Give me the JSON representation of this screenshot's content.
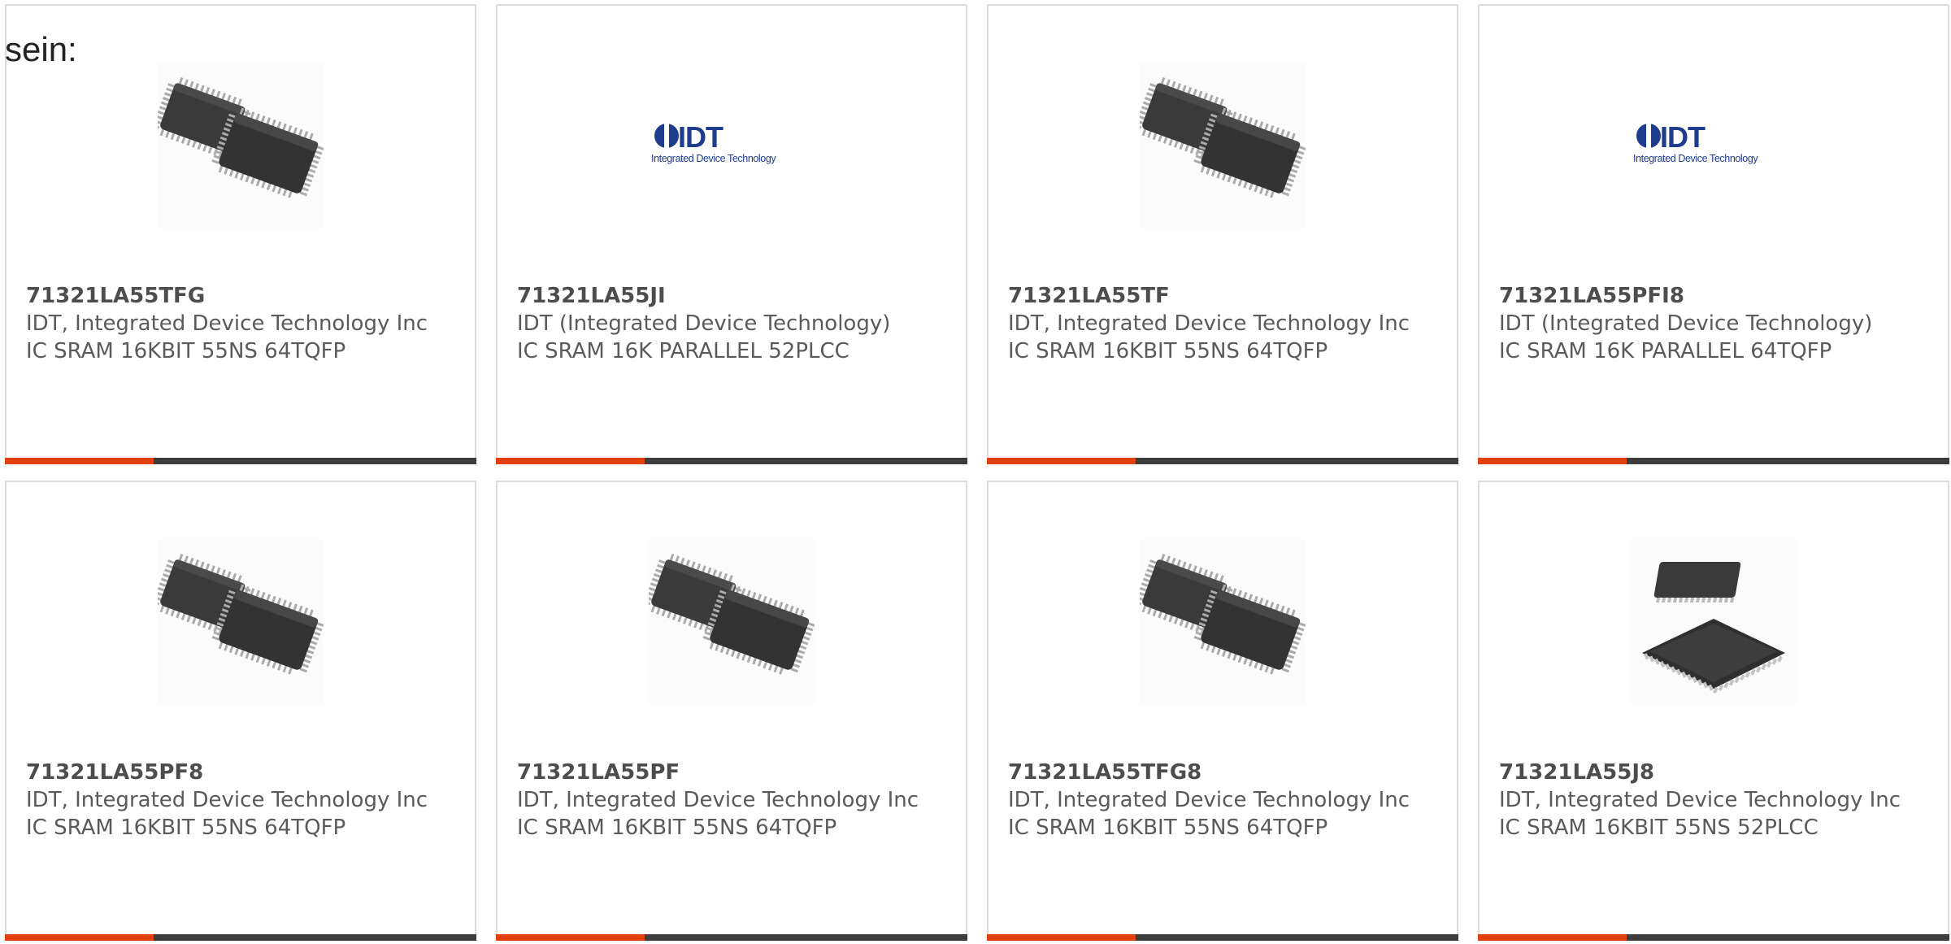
{
  "intro_text": "sein:",
  "colors": {
    "accent": "#e2400c",
    "bar": "#3d3d3d",
    "text": "#5a5a5a",
    "logo_blue": "#1e3c8c"
  },
  "logo": {
    "wordmark": "IDT",
    "tagline": "Integrated Device Technology"
  },
  "products": [
    {
      "part": "71321LA55TFG",
      "manufacturer": "IDT, Integrated Device Technology Inc",
      "description": "IC SRAM 16KBIT 55NS 64TQFP",
      "image": "tqfp-chip-image"
    },
    {
      "part": "71321LA55JI",
      "manufacturer": "IDT (Integrated Device Technology)",
      "description": "IC SRAM 16K PARALLEL 52PLCC",
      "image": "idt-logo-image"
    },
    {
      "part": "71321LA55TF",
      "manufacturer": "IDT, Integrated Device Technology Inc",
      "description": "IC SRAM 16KBIT 55NS 64TQFP",
      "image": "tqfp-chip-image"
    },
    {
      "part": "71321LA55PFI8",
      "manufacturer": "IDT (Integrated Device Technology)",
      "description": "IC SRAM 16K PARALLEL 64TQFP",
      "image": "idt-logo-image"
    },
    {
      "part": "71321LA55PF8",
      "manufacturer": "IDT, Integrated Device Technology Inc",
      "description": "IC SRAM 16KBIT 55NS 64TQFP",
      "image": "tqfp-chip-image"
    },
    {
      "part": "71321LA55PF",
      "manufacturer": "IDT, Integrated Device Technology Inc",
      "description": "IC SRAM 16KBIT 55NS 64TQFP",
      "image": "tqfp-chip-image"
    },
    {
      "part": "71321LA55TFG8",
      "manufacturer": "IDT, Integrated Device Technology Inc",
      "description": "IC SRAM 16KBIT 55NS 64TQFP",
      "image": "tqfp-chip-image"
    },
    {
      "part": "71321LA55J8",
      "manufacturer": "IDT, Integrated Device Technology Inc",
      "description": "IC SRAM 16KBIT 55NS 52PLCC",
      "image": "plcc-chip-image"
    }
  ]
}
